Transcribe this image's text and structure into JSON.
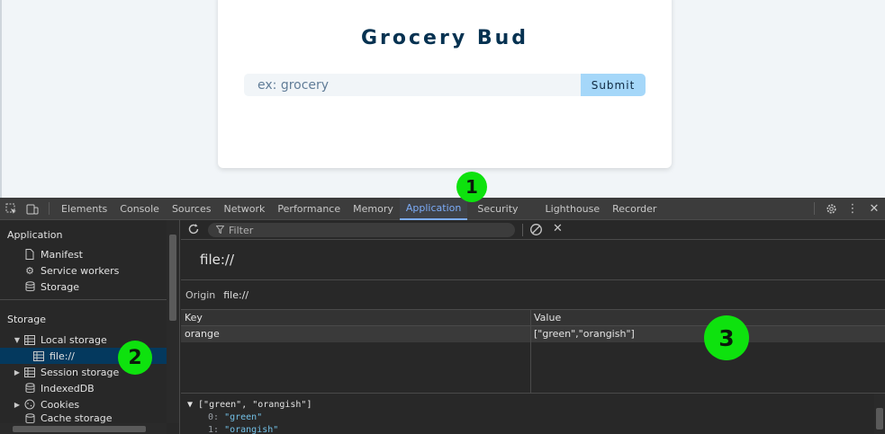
{
  "page": {
    "title": "Grocery Bud",
    "input_placeholder": "ex: grocery",
    "submit_label": "Submit"
  },
  "devtools": {
    "tabs": [
      "Elements",
      "Console",
      "Sources",
      "Network",
      "Performance",
      "Memory",
      "Application",
      "Security",
      "Lighthouse",
      "Recorder"
    ],
    "active_tab": "Application",
    "sidebar": {
      "application_header": "Application",
      "application_items": [
        "Manifest",
        "Service workers",
        "Storage"
      ],
      "storage_header": "Storage",
      "local_storage": "Local storage",
      "local_storage_child": "file://",
      "session_storage": "Session storage",
      "indexeddb": "IndexedDB",
      "cookies": "Cookies",
      "cache_storage": "Cache storage"
    },
    "filter_placeholder": "Filter",
    "origin_title": "file://",
    "origin_label": "Origin",
    "origin_value": "file://",
    "table": {
      "columns": [
        "Key",
        "Value"
      ],
      "rows": [
        {
          "key": "orange",
          "value": "[\"green\",\"orangish\"]"
        }
      ]
    },
    "preview": {
      "line1": "▼ [\"green\", \"orangish\"]",
      "item0_index": "0:",
      "item0_value": "\"green\"",
      "item1_index": "1:",
      "item1_value": "\"orangish\""
    }
  },
  "annotations": [
    "1",
    "2",
    "3"
  ],
  "colors": {
    "title": "#063251",
    "submit_bg": "#a5d7f9",
    "active_tab": "#7cacf8",
    "selected_row": "#04395e",
    "badge": "#0ee20e"
  }
}
